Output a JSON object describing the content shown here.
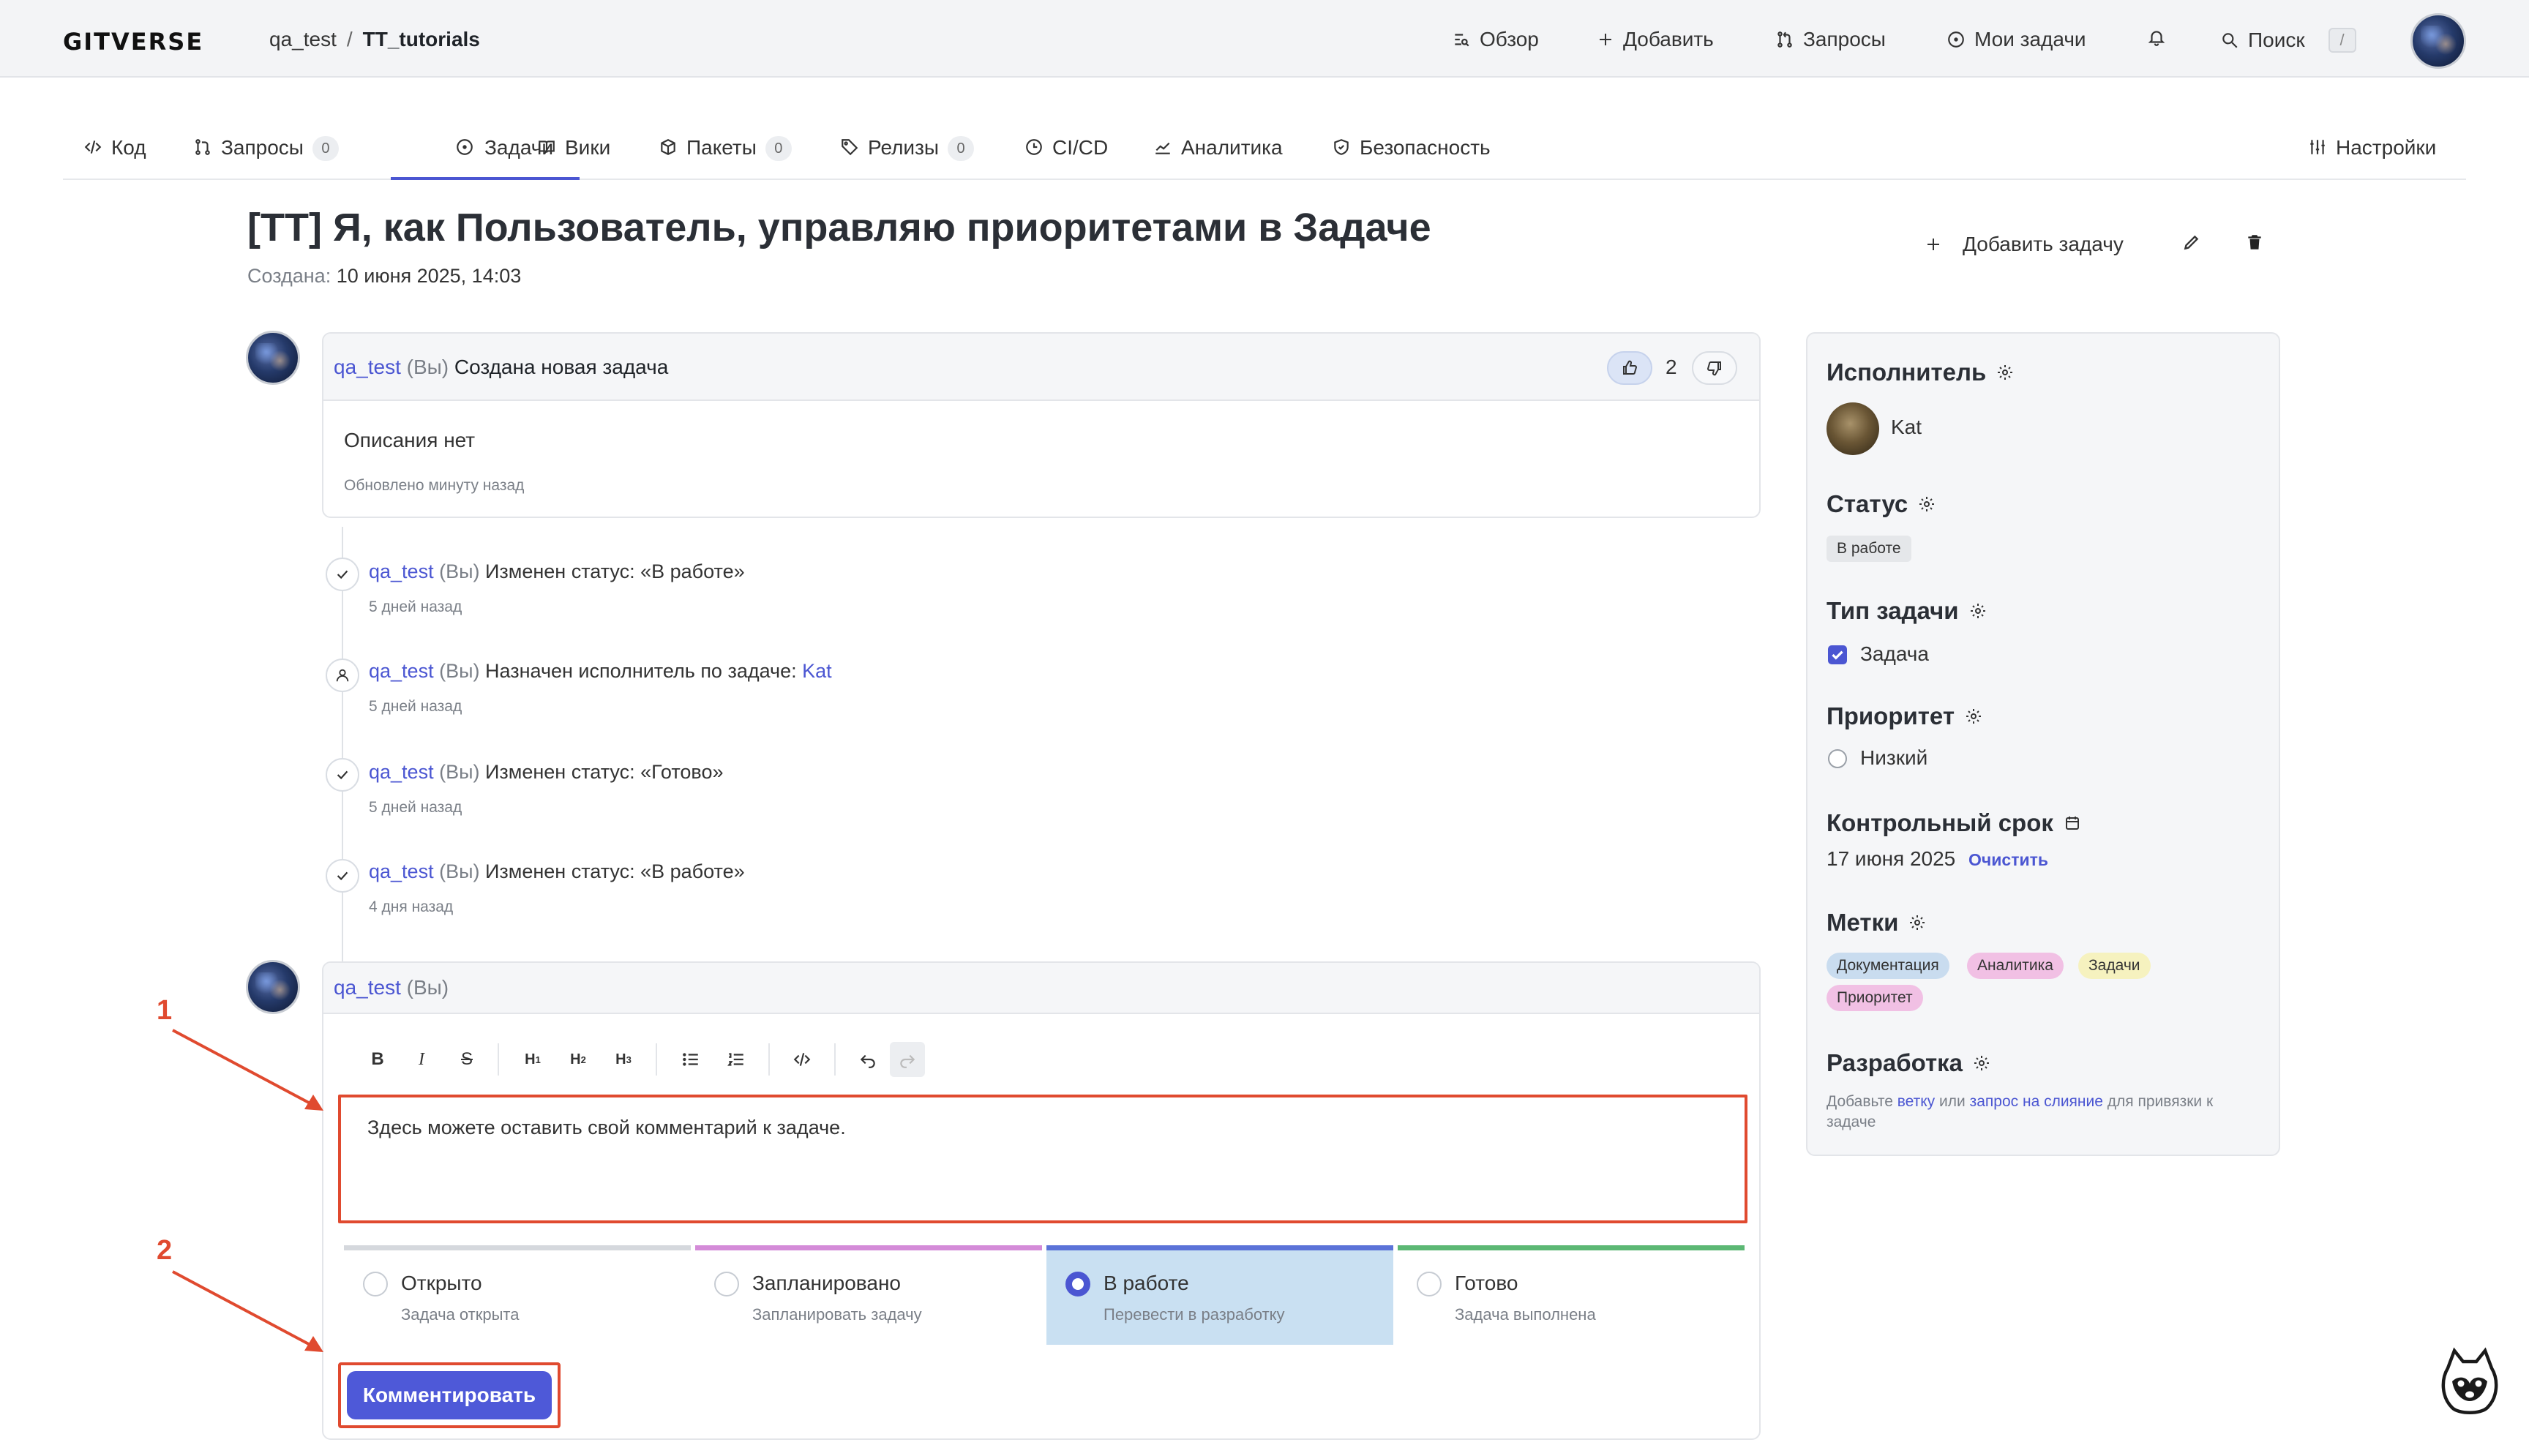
{
  "header": {
    "logo": "GITVERSE",
    "breadcrumb": {
      "owner": "qa_test",
      "repo": "TT_tutorials"
    },
    "nav": {
      "overview": "Обзор",
      "add": "Добавить",
      "requests": "Запросы",
      "my_tasks": "Мои задачи",
      "search": "Поиск",
      "search_hotkey": "/"
    }
  },
  "repo_tabs": [
    {
      "label": "Код"
    },
    {
      "label": "Запросы",
      "count": "0"
    },
    {
      "label": "Задачи"
    },
    {
      "label": "Вики"
    },
    {
      "label": "Пакеты",
      "count": "0"
    },
    {
      "label": "Релизы",
      "count": "0"
    },
    {
      "label": "CI/CD"
    },
    {
      "label": "Аналитика"
    },
    {
      "label": "Безопасность"
    }
  ],
  "settings_label": "Настройки",
  "issue": {
    "title": "[TT] Я, как Пользователь, управляю приоритетами в Задаче",
    "created_label": "Создана:",
    "created_value": "10 июня 2025, 14:03",
    "add_task": "Добавить задачу"
  },
  "first_comment": {
    "user": "qa_test",
    "you": "(Вы)",
    "action": "Создана новая задача",
    "likes": "2",
    "body": "Описания нет",
    "updated": "Обновлено минуту назад"
  },
  "timeline": [
    {
      "icon": "check-icon",
      "user": "qa_test",
      "you": "(Вы)",
      "text": "Изменен статус: «В работе»",
      "link": "",
      "time": "5 дней назад"
    },
    {
      "icon": "user-icon",
      "user": "qa_test",
      "you": "(Вы)",
      "text": "Назначен исполнитель по задаче:",
      "link": "Kat",
      "time": "5 дней назад"
    },
    {
      "icon": "check-icon",
      "user": "qa_test",
      "you": "(Вы)",
      "text": "Изменен статус: «Готово»",
      "link": "",
      "time": "5 дней назад"
    },
    {
      "icon": "check-icon",
      "user": "qa_test",
      "you": "(Вы)",
      "text": "Изменен статус: «В работе»",
      "link": "",
      "time": "4 дня назад"
    }
  ],
  "editor": {
    "user": "qa_test",
    "you": "(Вы)",
    "placeholder": "Здесь можете оставить свой комментарий к задаче.",
    "toolbar": [
      "B",
      "I",
      "S",
      "H1",
      "H2",
      "H3",
      "ul",
      "ol",
      "code",
      "undo",
      "redo"
    ],
    "statuses": [
      {
        "name": "Открыто",
        "desc": "Задача открыта",
        "color": "#d5d8dd",
        "selected": false
      },
      {
        "name": "Запланировано",
        "desc": "Запланировать задачу",
        "color": "#d48bd8",
        "selected": false
      },
      {
        "name": "В работе",
        "desc": "Перевести в разработку",
        "color": "#5b73d8",
        "selected": true
      },
      {
        "name": "Готово",
        "desc": "Задача выполнена",
        "color": "#5cb874",
        "selected": false
      }
    ],
    "submit": "Комментировать"
  },
  "sidebar": {
    "assignee": {
      "title": "Исполнитель",
      "name": "Kat"
    },
    "status": {
      "title": "Статус",
      "value": "В работе"
    },
    "type": {
      "title": "Тип задачи",
      "value": "Задача"
    },
    "priority": {
      "title": "Приоритет",
      "value": "Низкий"
    },
    "deadline": {
      "title": "Контрольный срок",
      "value": "17 июня 2025",
      "clear": "Очистить"
    },
    "labels": {
      "title": "Метки",
      "items": [
        {
          "name": "Документация",
          "color": "#c9dcef"
        },
        {
          "name": "Аналитика",
          "color": "#f1c0e4"
        },
        {
          "name": "Задачи",
          "color": "#f6f2bf"
        },
        {
          "name": "Приоритет",
          "color": "#f1c0e4"
        }
      ]
    },
    "dev": {
      "title": "Разработка",
      "text1": "Добавьте",
      "link1": "ветку",
      "text2": "или",
      "link2": "запрос на слияние",
      "text3": "для привязки к",
      "text4": "задаче"
    }
  },
  "annotations": {
    "first": "1",
    "second": "2"
  }
}
